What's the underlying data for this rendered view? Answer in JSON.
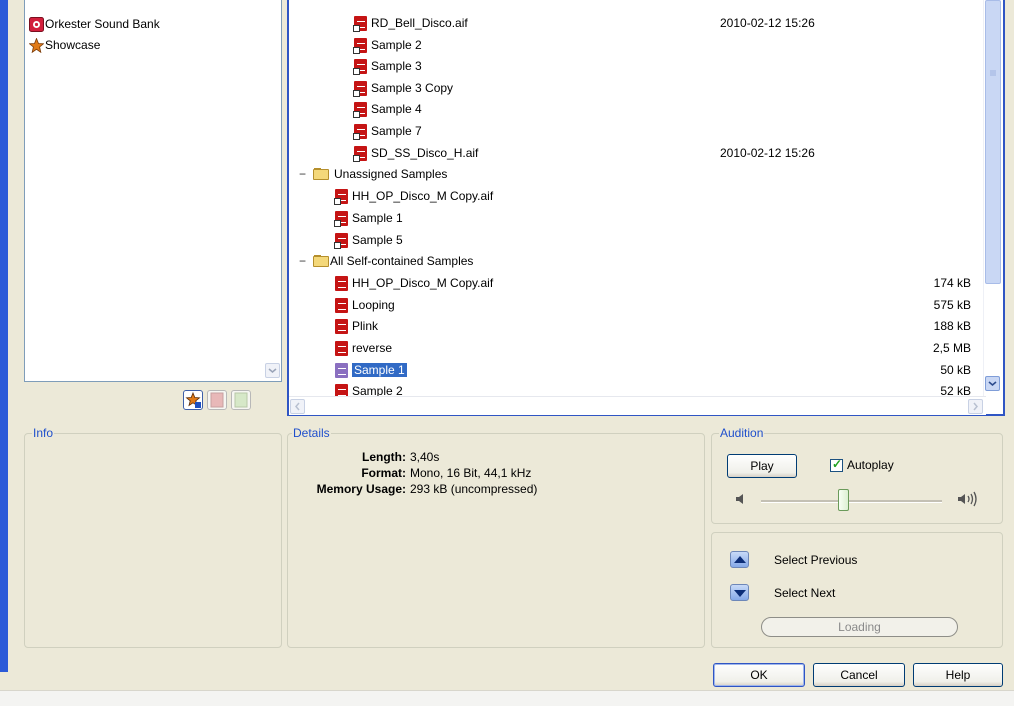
{
  "banks": {
    "items": [
      {
        "label": "Orkester Sound Bank",
        "icon": "sound-bank-icon"
      },
      {
        "label": "Showcase",
        "icon": "star-icon"
      }
    ]
  },
  "tree": {
    "rows": [
      {
        "label": "RD_Bell_Disco.aif",
        "date": "2010-02-12 15:26"
      },
      {
        "label": "Sample 2"
      },
      {
        "label": "Sample 3"
      },
      {
        "label": "Sample 3 Copy"
      },
      {
        "label": "Sample 4"
      },
      {
        "label": "Sample 7"
      },
      {
        "label": "SD_SS_Disco_H.aif",
        "date": "2010-02-12 15:26"
      },
      {
        "label": "Unassigned Samples"
      },
      {
        "label": "HH_OP_Disco_M Copy.aif"
      },
      {
        "label": "Sample 1"
      },
      {
        "label": "Sample 5"
      },
      {
        "label": "All Self-contained Samples"
      },
      {
        "label": "HH_OP_Disco_M Copy.aif",
        "size": "174 kB"
      },
      {
        "label": "Looping",
        "size": "575 kB"
      },
      {
        "label": "Plink",
        "size": "188 kB"
      },
      {
        "label": "reverse",
        "size": "2,5 MB"
      },
      {
        "label": "Sample 1",
        "size": "50 kB"
      },
      {
        "label": "Sample 2",
        "size": "52 kB"
      }
    ]
  },
  "info": {
    "title": "Info"
  },
  "details": {
    "title": "Details",
    "length_label": "Length:",
    "length_value": "3,40s",
    "format_label": "Format:",
    "format_value": "Mono, 16 Bit, 44,1 kHz",
    "memory_label": "Memory Usage:",
    "memory_value": "293 kB (uncompressed)"
  },
  "audition": {
    "title": "Audition",
    "play": "Play",
    "autoplay": "Autoplay",
    "autoplay_checked": true,
    "volume": 0.5
  },
  "navigation": {
    "select_previous": "Select Previous",
    "select_next": "Select Next",
    "loading": "Loading"
  },
  "footer": {
    "ok": "OK",
    "cancel": "Cancel",
    "help": "Help"
  },
  "colors": {
    "selection": "#316ac5",
    "group_label": "#1f4fcc",
    "focus_border": "#2f55c4"
  }
}
